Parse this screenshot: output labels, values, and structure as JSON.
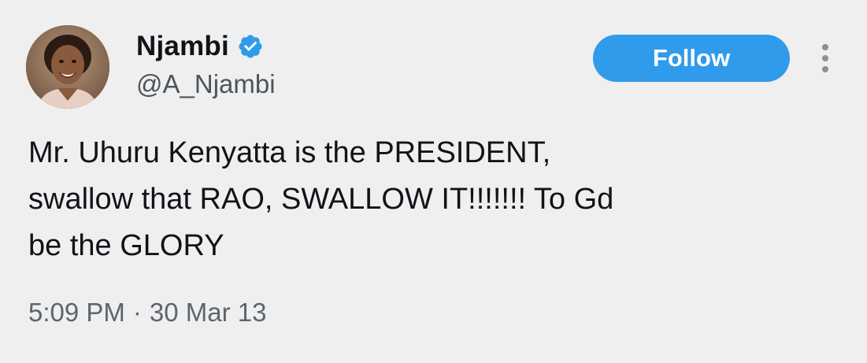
{
  "tweet": {
    "author": {
      "display_name": "Njambi",
      "handle": "@A_Njambi",
      "verified": true,
      "avatar_icon": "profile-photo-woman-smiling"
    },
    "follow_label": "Follow",
    "text": "Mr. Uhuru Kenyatta is the PRESIDENT,\nswallow that RAO, SWALLOW IT!!!!!!! To Gd\nbe the GLORY",
    "time": "5:09 PM",
    "separator": "·",
    "date": "30 Mar 13"
  },
  "colors": {
    "background": "#efefef",
    "follow_button": "#2f9bea",
    "verified_badge": "#2f9bea",
    "secondary_text": "#5b656e"
  },
  "icons": {
    "verified": "verified-badge-icon",
    "more": "more-options-vertical-icon"
  }
}
